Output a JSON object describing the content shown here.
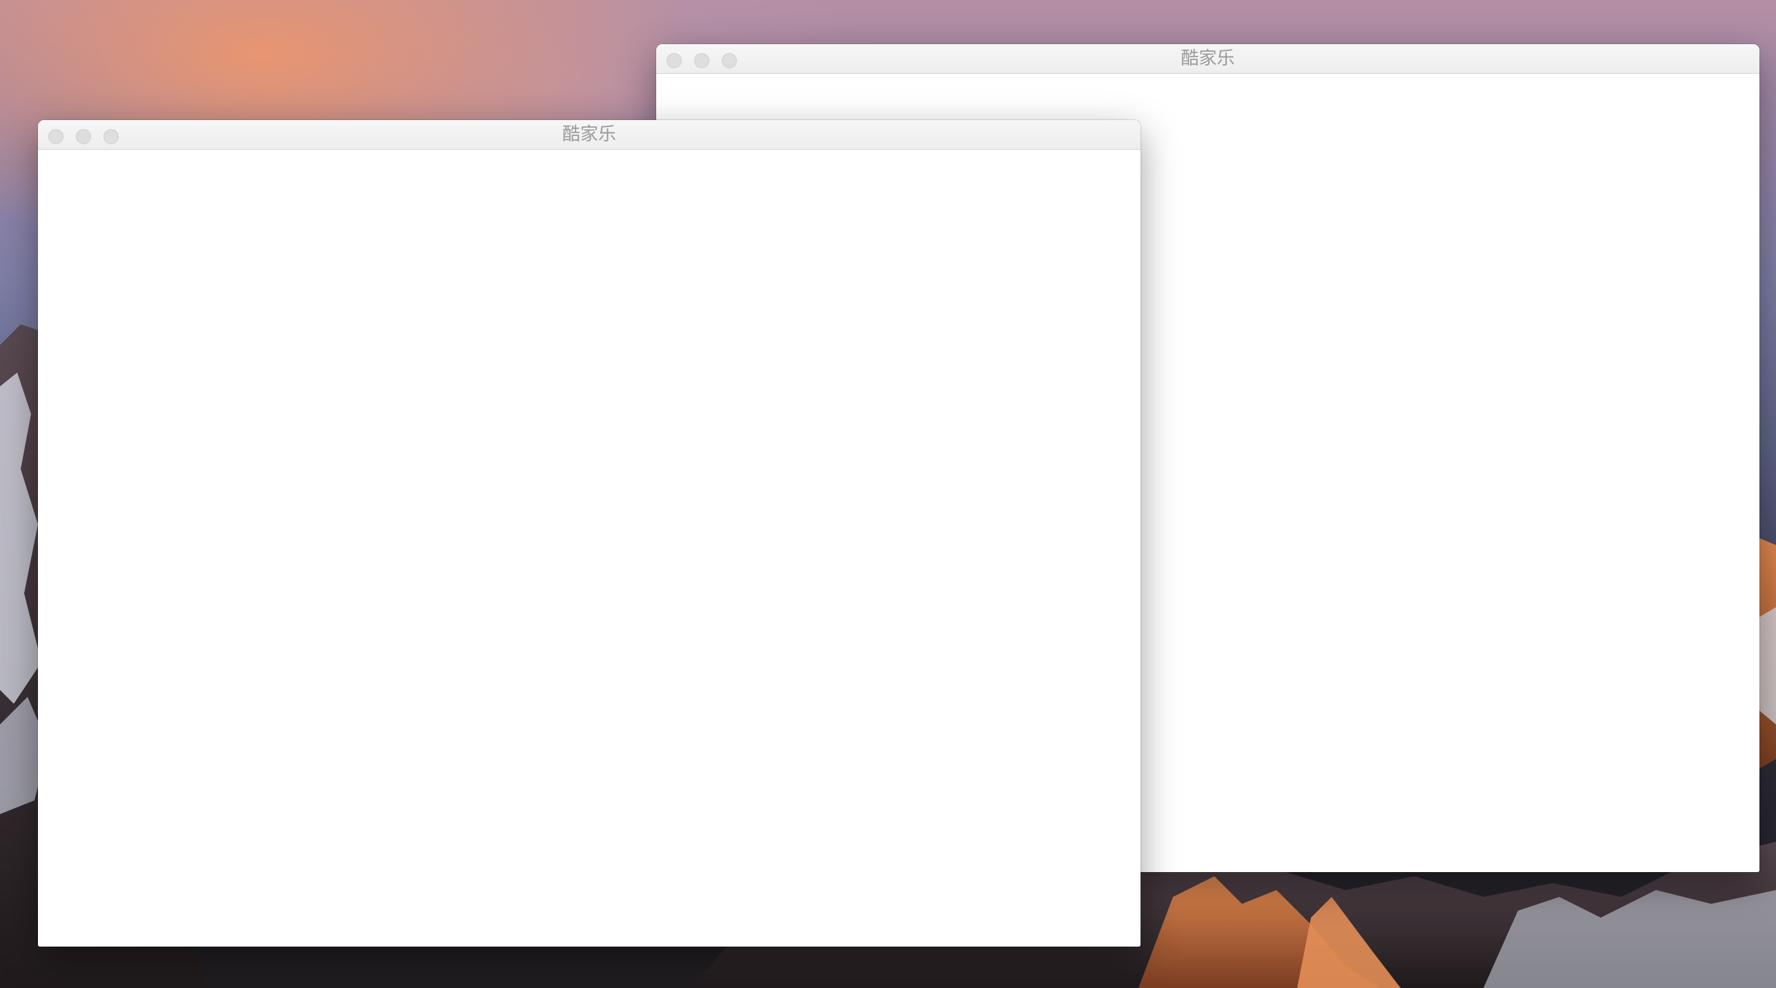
{
  "desktop": {
    "wallpaper": "mountain-sunset-wallpaper"
  },
  "windows": [
    {
      "id": "back",
      "title": "酷家乐",
      "controls": [
        "close-icon",
        "minimize-icon",
        "zoom-icon"
      ]
    },
    {
      "id": "front",
      "title": "酷家乐",
      "controls": [
        "close-icon",
        "minimize-icon",
        "zoom-icon"
      ]
    }
  ],
  "colors": {
    "titlebar": "#f6f6f6",
    "title_text": "#9a9a9a",
    "traffic_light_inactive": "#dedede",
    "content_background": "#ffffff"
  }
}
